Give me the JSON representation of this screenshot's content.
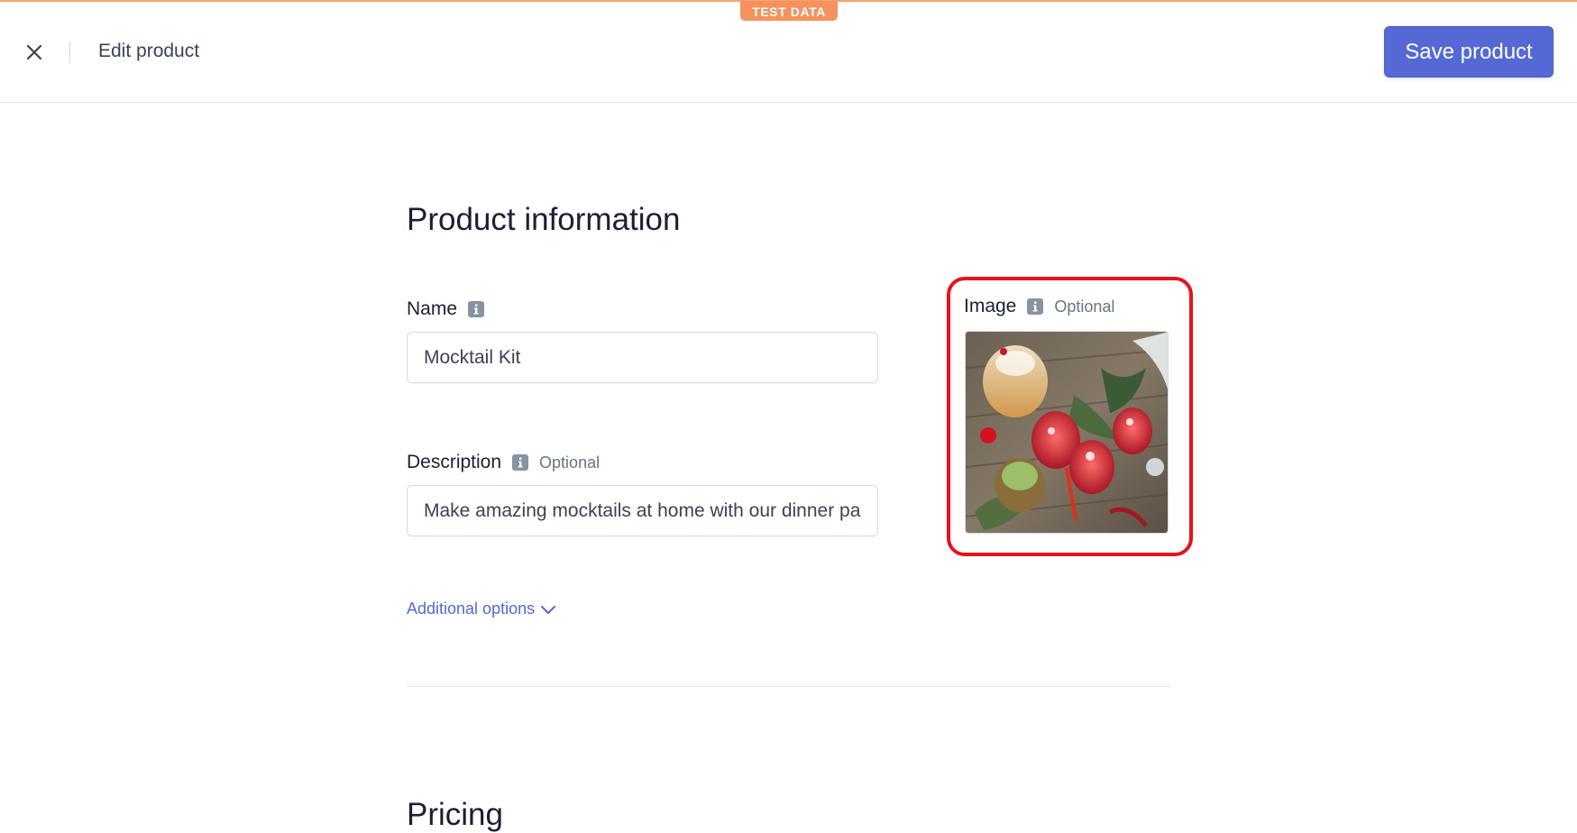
{
  "banner": {
    "label": "TEST DATA"
  },
  "header": {
    "title": "Edit product",
    "save_label": "Save product"
  },
  "section": {
    "title": "Product information"
  },
  "name_field": {
    "label": "Name",
    "value": "Mocktail Kit"
  },
  "description_field": {
    "label": "Description",
    "optional": "Optional",
    "value": "Make amazing mocktails at home with our dinner party kit"
  },
  "image_field": {
    "label": "Image",
    "optional": "Optional"
  },
  "additional_options": {
    "label": "Additional options"
  },
  "pricing": {
    "title": "Pricing"
  },
  "colors": {
    "accent": "#5469d4",
    "test_badge": "#f5925e",
    "highlight": "#e8121b"
  }
}
